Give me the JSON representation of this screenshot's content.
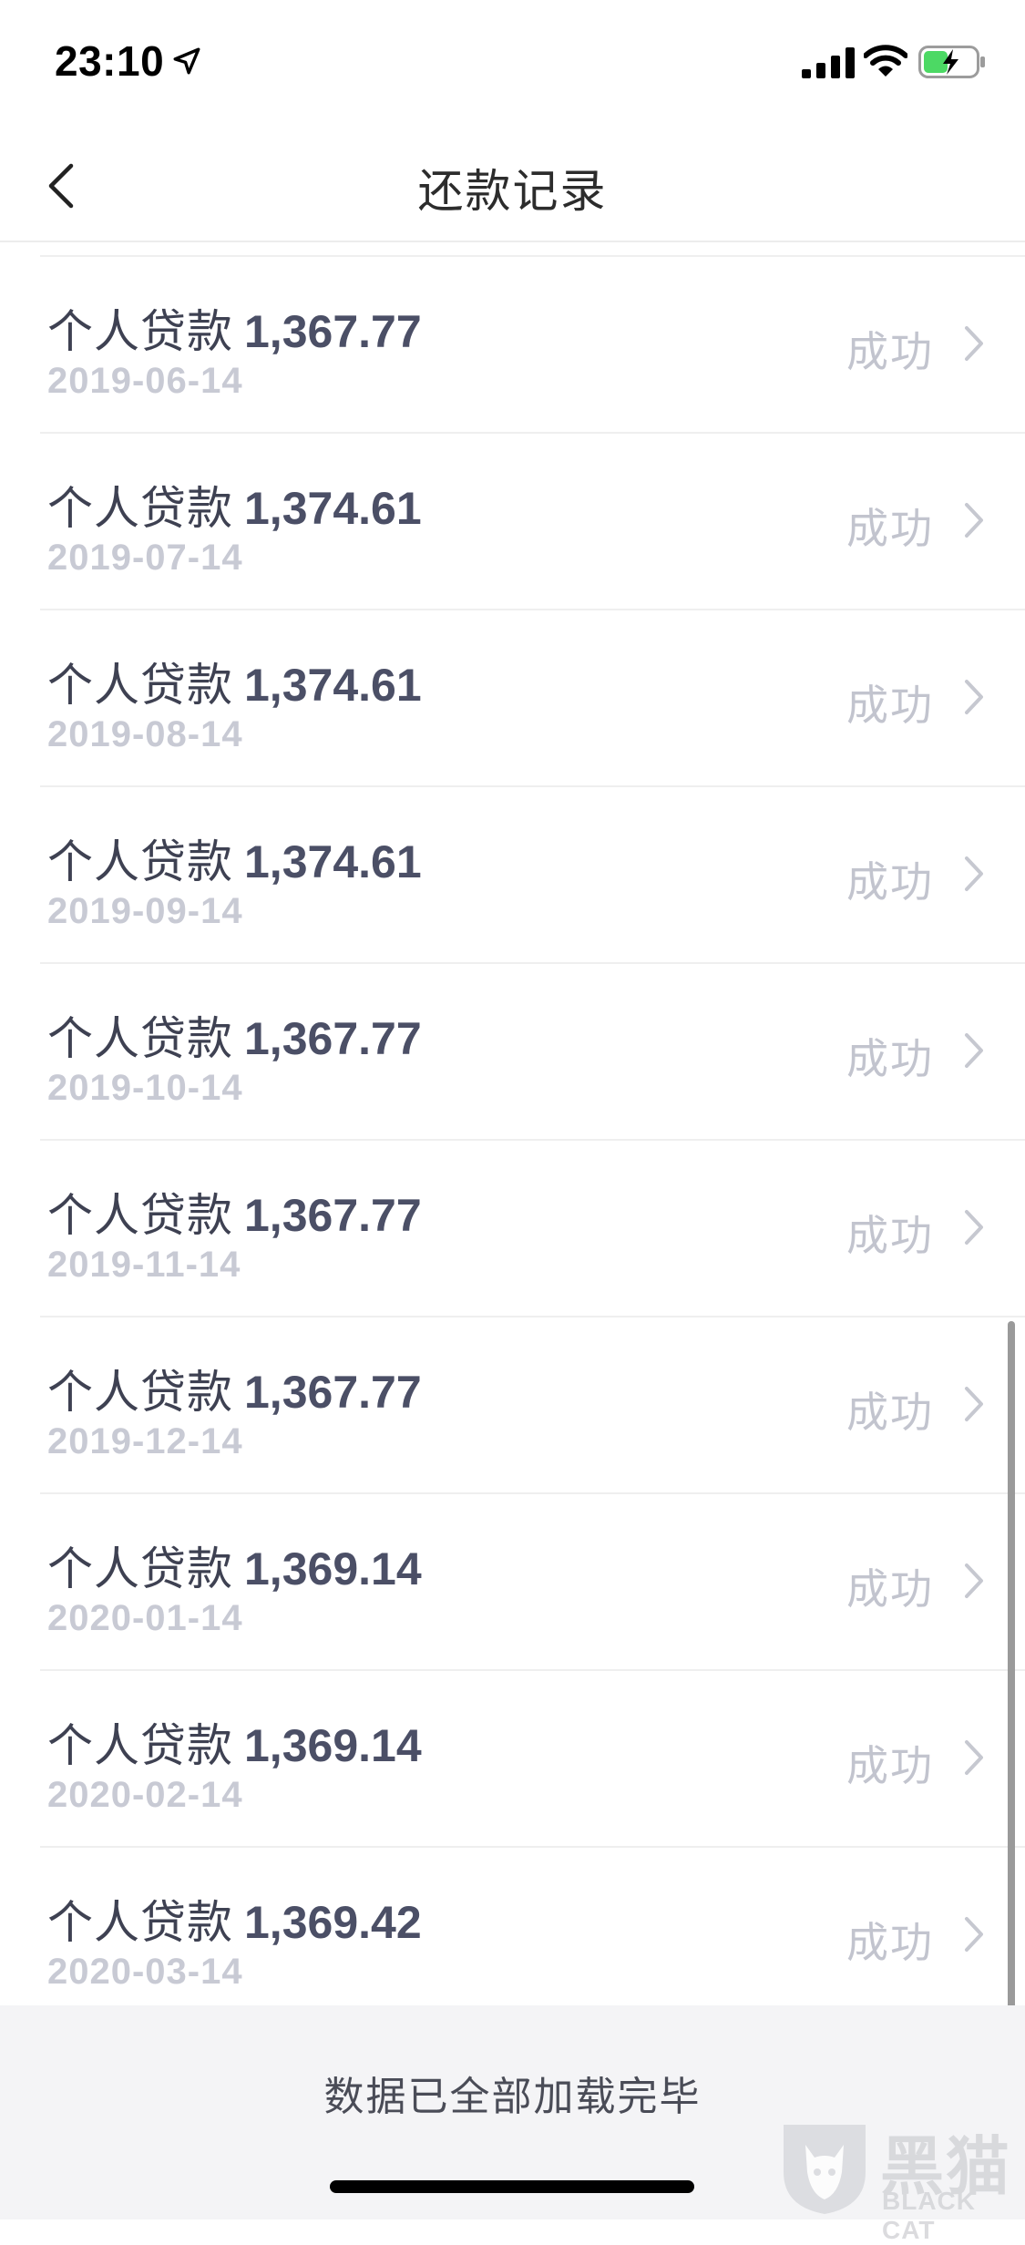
{
  "status_bar": {
    "time": "23:10",
    "icons": [
      "location-arrow-icon",
      "signal-icon",
      "wifi-icon",
      "battery-charging-icon"
    ]
  },
  "header": {
    "title": "还款记录",
    "back_icon": "chevron-left-icon"
  },
  "records": [
    {
      "label": "个人贷款",
      "amount": "1,367.77",
      "date": "2019-06-14",
      "status": "成功"
    },
    {
      "label": "个人贷款",
      "amount": "1,374.61",
      "date": "2019-07-14",
      "status": "成功"
    },
    {
      "label": "个人贷款",
      "amount": "1,374.61",
      "date": "2019-08-14",
      "status": "成功"
    },
    {
      "label": "个人贷款",
      "amount": "1,374.61",
      "date": "2019-09-14",
      "status": "成功"
    },
    {
      "label": "个人贷款",
      "amount": "1,367.77",
      "date": "2019-10-14",
      "status": "成功"
    },
    {
      "label": "个人贷款",
      "amount": "1,367.77",
      "date": "2019-11-14",
      "status": "成功"
    },
    {
      "label": "个人贷款",
      "amount": "1,367.77",
      "date": "2019-12-14",
      "status": "成功"
    },
    {
      "label": "个人贷款",
      "amount": "1,369.14",
      "date": "2020-01-14",
      "status": "成功"
    },
    {
      "label": "个人贷款",
      "amount": "1,369.14",
      "date": "2020-02-14",
      "status": "成功"
    },
    {
      "label": "个人贷款",
      "amount": "1,369.42",
      "date": "2020-03-14",
      "status": "成功"
    }
  ],
  "footer": {
    "text": "数据已全部加载完毕"
  },
  "watermark": {
    "cn": "黑猫",
    "en": "BLACK CAT"
  },
  "colors": {
    "label": "#3e4152",
    "amount": "#4b4f66",
    "date": "#c8cad4",
    "status": "#c2c4ce",
    "footer_bg": "#f4f4f6"
  }
}
